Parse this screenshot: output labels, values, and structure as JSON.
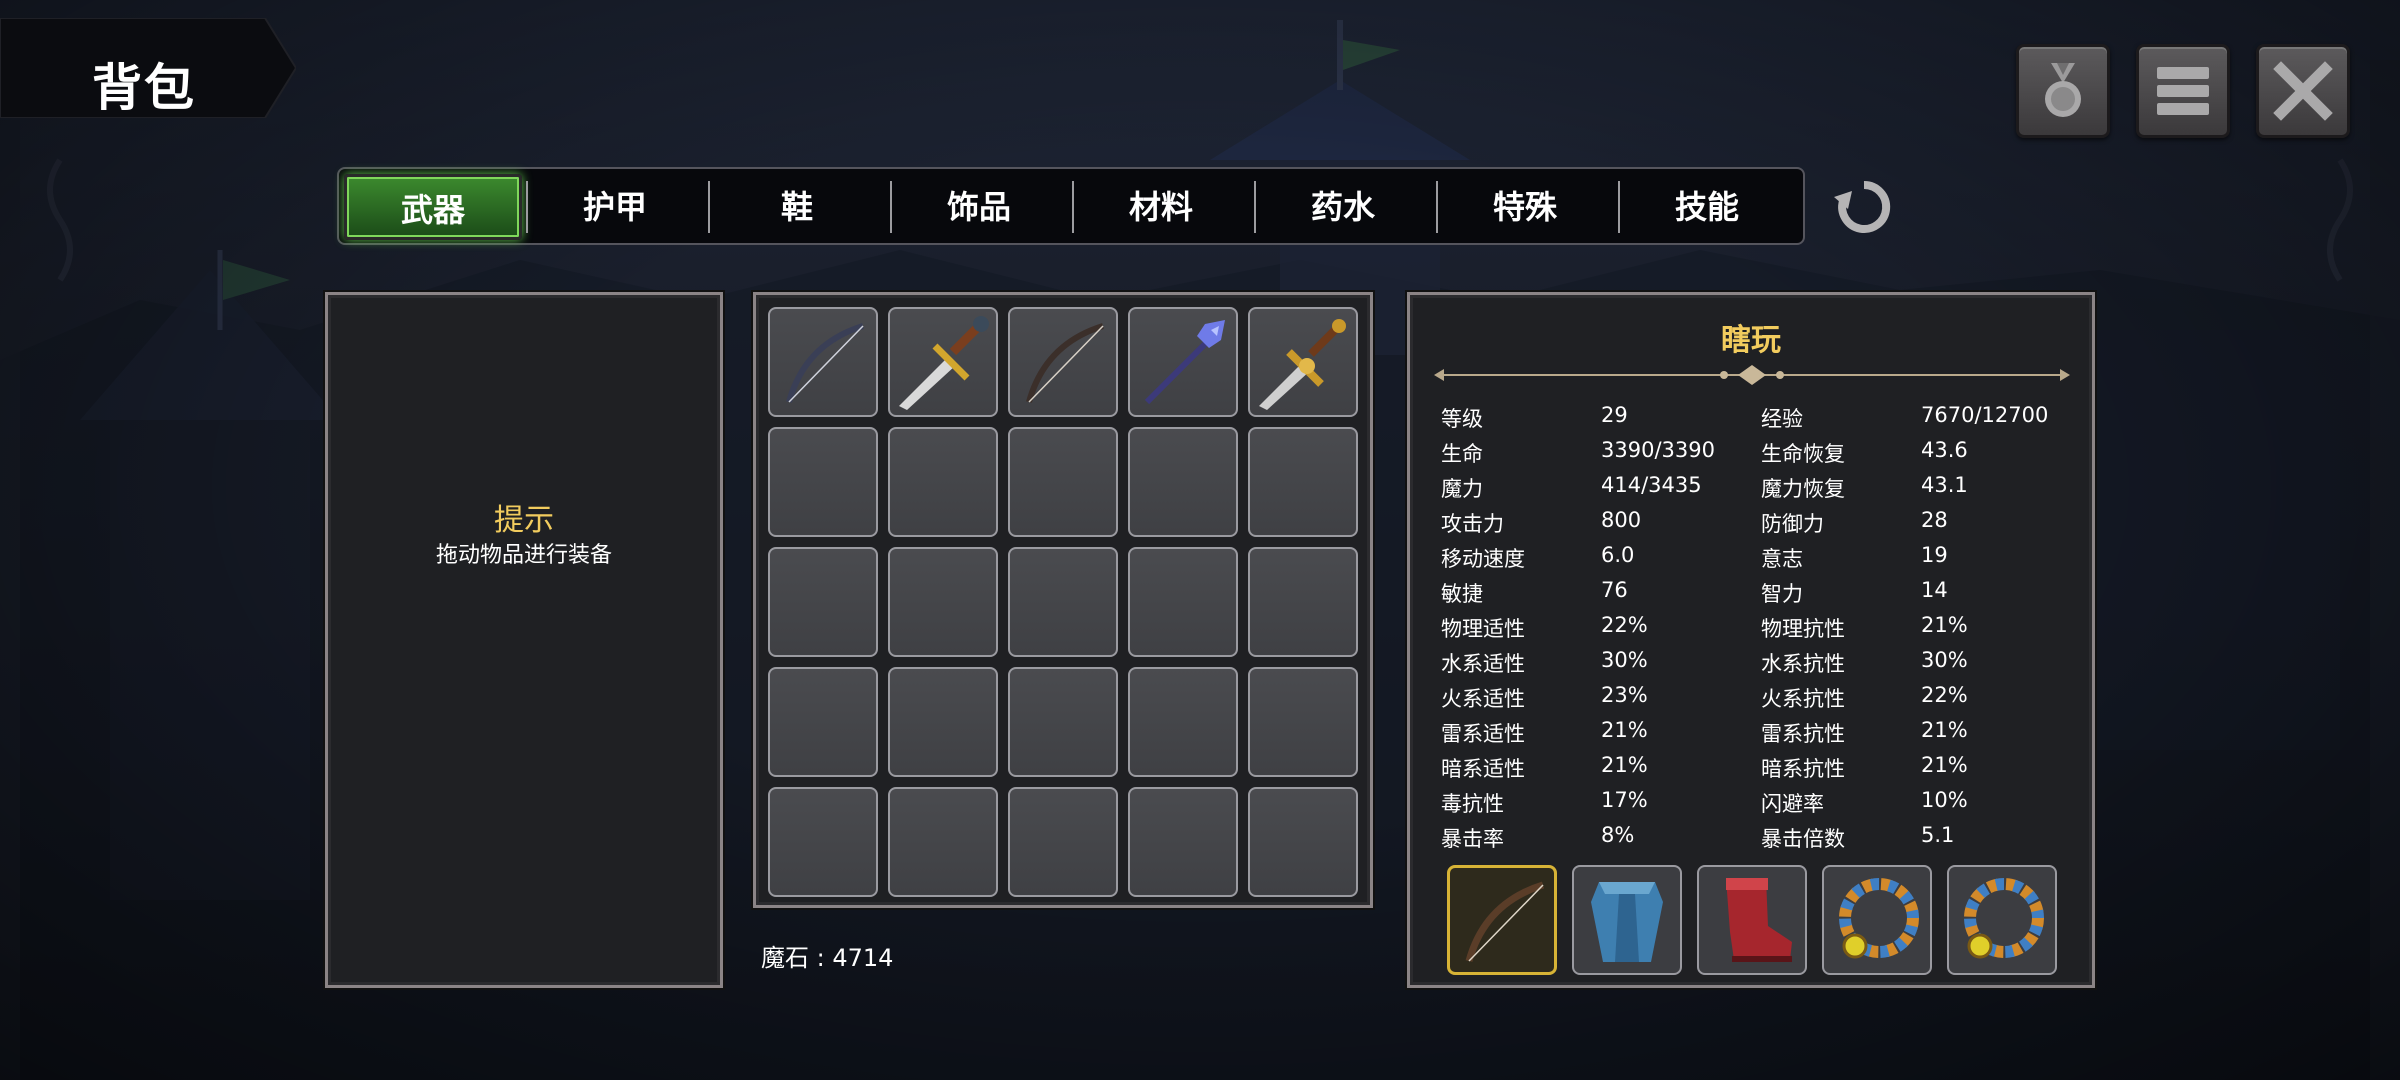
{
  "header": {
    "title": "背包"
  },
  "top_buttons": [
    {
      "name": "medal-button",
      "icon": "medal-icon"
    },
    {
      "name": "menu-button",
      "icon": "menu-icon"
    },
    {
      "name": "close-button",
      "icon": "close-icon"
    }
  ],
  "tabs": [
    "武器",
    "护甲",
    "鞋",
    "饰品",
    "材料",
    "药水",
    "特殊",
    "技能"
  ],
  "active_tab": "武器",
  "hint": {
    "title": "提示",
    "text": "拖动物品进行装备"
  },
  "inventory": {
    "items": [
      "bow-icon",
      "sword-icon",
      "bow-icon",
      "crystal-spear-icon",
      "golden-dagger-icon"
    ],
    "empty_slots": 20
  },
  "currency": {
    "label": "魔石 : 4714"
  },
  "character": {
    "name": "瞎玩",
    "stats_left": [
      {
        "label": "等级",
        "value": "29"
      },
      {
        "label": "生命",
        "value": "3390/3390"
      },
      {
        "label": "魔力",
        "value": "414/3435"
      },
      {
        "label": "攻击力",
        "value": "800"
      },
      {
        "label": "移动速度",
        "value": "6.0"
      },
      {
        "label": "敏捷",
        "value": "76"
      },
      {
        "label": "物理适性",
        "value": "22%"
      },
      {
        "label": "水系适性",
        "value": "30%"
      },
      {
        "label": "火系适性",
        "value": "23%"
      },
      {
        "label": "雷系适性",
        "value": "21%"
      },
      {
        "label": "暗系适性",
        "value": "21%"
      },
      {
        "label": "毒抗性",
        "value": "17%"
      },
      {
        "label": "暴击率",
        "value": "8%"
      }
    ],
    "stats_right": [
      {
        "label": "经验",
        "value": "7670/12700"
      },
      {
        "label": "生命恢复",
        "value": "43.6"
      },
      {
        "label": "魔力恢复",
        "value": "43.1"
      },
      {
        "label": "防御力",
        "value": "28"
      },
      {
        "label": "意志",
        "value": "19"
      },
      {
        "label": "智力",
        "value": "14"
      },
      {
        "label": "物理抗性",
        "value": "21%"
      },
      {
        "label": "水系抗性",
        "value": "30%"
      },
      {
        "label": "火系抗性",
        "value": "22%"
      },
      {
        "label": "雷系抗性",
        "value": "21%"
      },
      {
        "label": "暗系抗性",
        "value": "21%"
      },
      {
        "label": "闪避率",
        "value": "10%"
      },
      {
        "label": "暴击倍数",
        "value": "5.1"
      }
    ],
    "equipment": [
      "bow-icon",
      "blue-armor-icon",
      "red-boots-icon",
      "striped-ring-icon",
      "striped-ring-icon"
    ]
  },
  "colors": {
    "accent_gold": "#f2cc5e",
    "tab_active": "#3c8a2e",
    "equip_highlight": "#d7b336"
  }
}
